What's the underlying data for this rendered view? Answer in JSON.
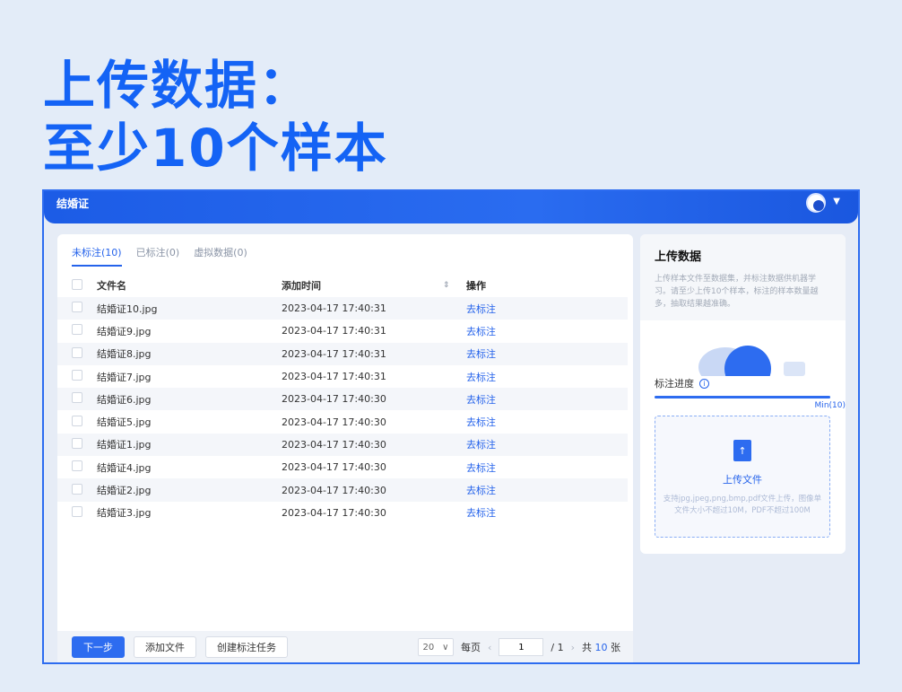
{
  "headline": {
    "line1": "上传数据：",
    "line2": "至少10个样本"
  },
  "topbar": {
    "title": "结婚证"
  },
  "tabs": [
    {
      "label": "未标注(10)"
    },
    {
      "label": "已标注(0)"
    },
    {
      "label": "虚拟数据(0)"
    }
  ],
  "table": {
    "headers": {
      "name": "文件名",
      "time": "添加时间",
      "op": "操作"
    },
    "rows": [
      {
        "name": "结婚证10.jpg",
        "time": "2023-04-17 17:40:31",
        "op": "去标注"
      },
      {
        "name": "结婚证9.jpg",
        "time": "2023-04-17 17:40:31",
        "op": "去标注"
      },
      {
        "name": "结婚证8.jpg",
        "time": "2023-04-17 17:40:31",
        "op": "去标注"
      },
      {
        "name": "结婚证7.jpg",
        "time": "2023-04-17 17:40:31",
        "op": "去标注"
      },
      {
        "name": "结婚证6.jpg",
        "time": "2023-04-17 17:40:30",
        "op": "去标注"
      },
      {
        "name": "结婚证5.jpg",
        "time": "2023-04-17 17:40:30",
        "op": "去标注"
      },
      {
        "name": "结婚证1.jpg",
        "time": "2023-04-17 17:40:30",
        "op": "去标注"
      },
      {
        "name": "结婚证4.jpg",
        "time": "2023-04-17 17:40:30",
        "op": "去标注"
      },
      {
        "name": "结婚证2.jpg",
        "time": "2023-04-17 17:40:30",
        "op": "去标注"
      },
      {
        "name": "结婚证3.jpg",
        "time": "2023-04-17 17:40:30",
        "op": "去标注"
      }
    ]
  },
  "footer": {
    "next": "下一步",
    "add_file": "添加文件",
    "create_task": "创建标注任务",
    "page_size": "20",
    "per_page": "每页",
    "page_value": "1",
    "page_of": "/ 1",
    "total_prefix": "共",
    "total_count": "10",
    "total_suffix": "张"
  },
  "upload_panel": {
    "title": "上传数据",
    "description": "上传样本文件至数据集，并标注数据供机器学习。请至少上传10个样本，标注的样本数量越多，抽取结果越准确。",
    "progress_label": "标注进度",
    "progress_fraction": 1.0,
    "progress_min": "Min(10)",
    "drop_title": "上传文件",
    "drop_hint": "支持jpg,jpeg,png,bmp,pdf文件上传，图像单文件大小不超过10M，PDF不超过100M"
  },
  "icons": {
    "avatar": "user-avatar",
    "caret": "chevron-down-icon",
    "sort": "sort-icon",
    "info": "info-icon",
    "file_upload": "file-upload-icon"
  },
  "colors": {
    "accent": "#1463f5",
    "primary": "#2d6cf0",
    "link": "#2563eb"
  }
}
